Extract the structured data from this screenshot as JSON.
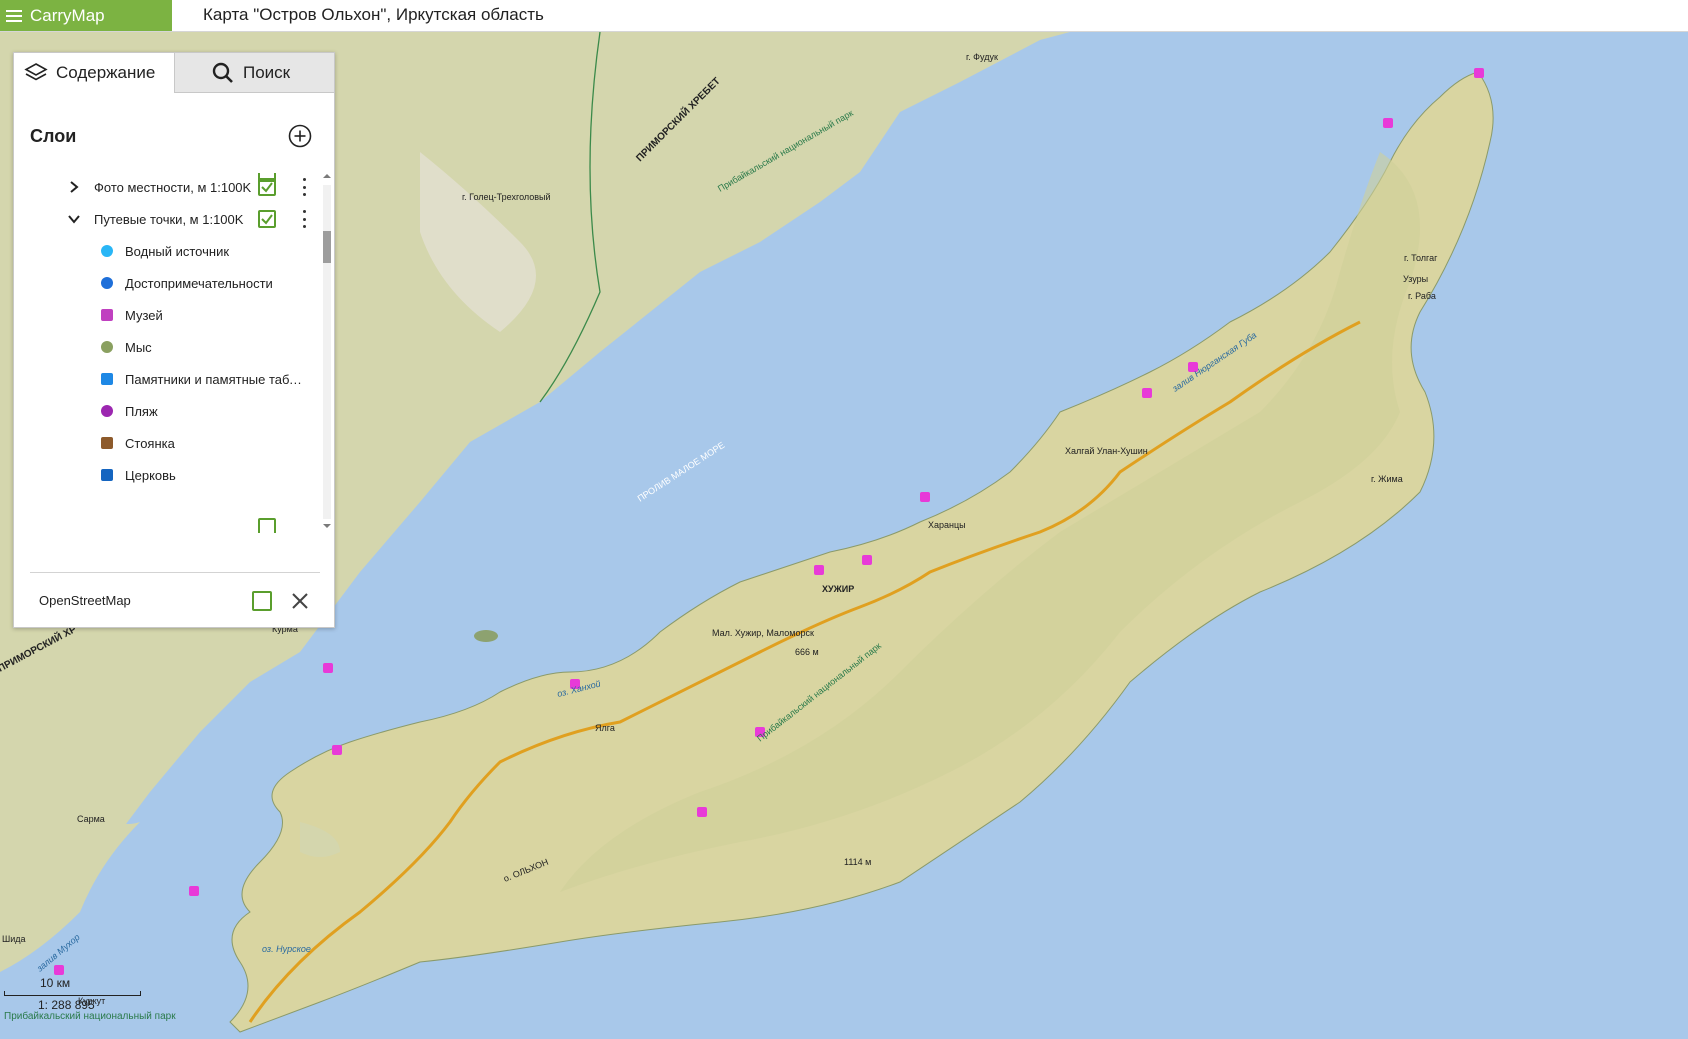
{
  "app": {
    "name": "CarryMap",
    "map_title": "Карта \"Остров Ольхон\", Иркутская область"
  },
  "panel": {
    "tabs": [
      {
        "label": "Содержание",
        "icon": "layers-icon"
      },
      {
        "label": "Поиск",
        "icon": "search-icon"
      }
    ],
    "layers_title": "Слои",
    "layers": [
      {
        "label": "Фото местности, м 1:100K",
        "expanded": false,
        "checked": true
      },
      {
        "label": "Путевые точки, м 1:100K",
        "expanded": true,
        "checked": true
      }
    ],
    "legend_items": [
      {
        "label": "Водный источник",
        "icon": "water-source-icon",
        "color": "#29b6f6"
      },
      {
        "label": "Достопримечательности",
        "icon": "sight-icon",
        "color": "#1e6fd9"
      },
      {
        "label": "Музей",
        "icon": "museum-icon",
        "color": "#c040c0"
      },
      {
        "label": "Мыс",
        "icon": "cape-icon",
        "color": "#8aa060"
      },
      {
        "label": "Памятники и памятные табл...",
        "icon": "monument-icon",
        "color": "#1e88e5"
      },
      {
        "label": "Пляж",
        "icon": "beach-icon",
        "color": "#9c27b0"
      },
      {
        "label": "Стоянка",
        "icon": "camp-icon",
        "color": "#8d5a2b"
      },
      {
        "label": "Церковь",
        "icon": "church-icon",
        "color": "#1565c0"
      }
    ],
    "base_layer": {
      "label": "OpenStreetMap",
      "checked": false
    }
  },
  "map_labels": {
    "ridge": "ПРИМОРСКИЙ ХРЕБЕТ",
    "ridge_left": "ПРИМОРСКИЙ ХР",
    "park": "Прибайкальский национальный парк",
    "strait": "ПРОЛИВ МАЛОЕ МОРЕ",
    "island": "о. ОЛЬХОН",
    "khuzhir": "ХУЖИР",
    "kharantsy": "Харанцы",
    "khalgai": "Халгай Улан-Хушин",
    "yalga": "Ялга",
    "mal_khuzhir": "Мал. Хужир, Маломорск",
    "peak_666": "666 м",
    "peak_1114": "1114 м",
    "golets": "г. Голец-Трехголовый",
    "zhima": "г. Жима",
    "tolgai": "г. Толгаг",
    "uzury": "Узуры",
    "raba": "г. Раба",
    "bay": "залив Нюрганская Губа",
    "khankoi": "оз. Ханхой",
    "nurskoe": "оз. Нурское",
    "sarma": "Сарма",
    "kurma": "Курма",
    "shida": "Шида",
    "mukhor": "залив Мухор",
    "kurkut": "Куркут",
    "fuduk": "г. Фудук"
  },
  "scale": {
    "distance": "10 км",
    "ratio": "1: 288 895",
    "park": "Прибайкальский национальный парк"
  },
  "colors": {
    "brand": "#7cb342",
    "water": "#a8c8ea",
    "land": "#d8d7a2",
    "mainland": "#cfd2a4",
    "poi": "#e83ad8",
    "road": "#e0a020"
  }
}
